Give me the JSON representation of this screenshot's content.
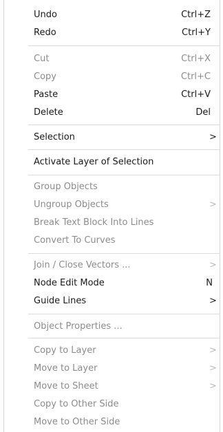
{
  "menu": {
    "undo": {
      "label": "Undo",
      "shortcut": "Ctrl+Z"
    },
    "redo": {
      "label": "Redo",
      "shortcut": "Ctrl+Y"
    },
    "cut": {
      "label": "Cut",
      "shortcut": "Ctrl+X"
    },
    "copy": {
      "label": "Copy",
      "shortcut": "Ctrl+C"
    },
    "paste": {
      "label": "Paste",
      "shortcut": "Ctrl+V"
    },
    "delete": {
      "label": "Delete",
      "shortcut": "Del"
    },
    "selection": {
      "label": "Selection",
      "arrow": ">"
    },
    "activate_layer": {
      "label": "Activate Layer of Selection"
    },
    "group_objects": {
      "label": "Group Objects"
    },
    "ungroup_objects": {
      "label": "Ungroup Objects",
      "arrow": ">"
    },
    "break_text": {
      "label": "Break Text Block Into Lines"
    },
    "convert_curves": {
      "label": "Convert To Curves"
    },
    "join_close": {
      "label": "Join / Close Vectors ...",
      "arrow": ">"
    },
    "node_edit": {
      "label": "Node Edit Mode",
      "shortcut": "N"
    },
    "guide_lines": {
      "label": "Guide Lines",
      "arrow": ">"
    },
    "object_properties": {
      "label": "Object Properties ..."
    },
    "copy_to_layer": {
      "label": "Copy to Layer",
      "arrow": ">"
    },
    "move_to_layer": {
      "label": "Move to Layer",
      "arrow": ">"
    },
    "move_to_sheet": {
      "label": "Move to Sheet",
      "arrow": ">"
    },
    "copy_other_side": {
      "label": "Copy to Other Side"
    },
    "move_other_side": {
      "label": "Move to Other Side"
    }
  },
  "colors": {
    "enabled_text": "#1a1a1a",
    "disabled_text": "#8c8c8c",
    "separator": "#dcdcdc"
  }
}
